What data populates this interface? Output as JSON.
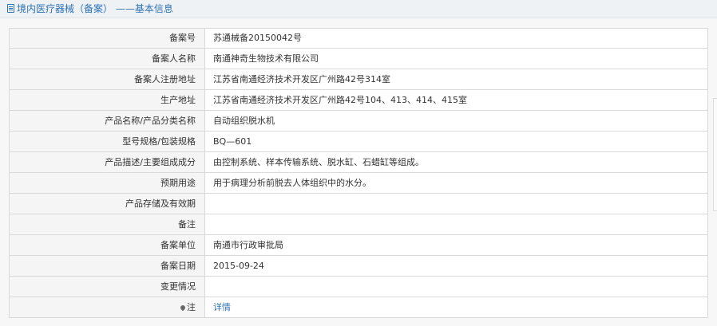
{
  "header": {
    "title": "境内医疗器械（备案） ——基本信息"
  },
  "rows": [
    {
      "label": "备案号",
      "value": "苏通械备20150042号"
    },
    {
      "label": "备案人名称",
      "value": "南通神奇生物技术有限公司"
    },
    {
      "label": "备案人注册地址",
      "value": "江苏省南通经济技术开发区广州路42号314室"
    },
    {
      "label": "生产地址",
      "value": "江苏省南通经济技术开发区广州路42号104、413、414、415室"
    },
    {
      "label": "产品名称/产品分类名称",
      "value": "自动组织脱水机"
    },
    {
      "label": "型号规格/包装规格",
      "value": "BQ—601"
    },
    {
      "label": "产品描述/主要组成成分",
      "value": "由控制系统、样本传输系统、脱水缸、石蜡缸等组成。"
    },
    {
      "label": "预期用途",
      "value": "用于病理分析前脱去人体组织中的水分。"
    },
    {
      "label": "产品存储及有效期",
      "value": ""
    },
    {
      "label": "备注",
      "value": ""
    },
    {
      "label": "备案单位",
      "value": "南通市行政审批局"
    },
    {
      "label": "备案日期",
      "value": "2015-09-24"
    },
    {
      "label": "变更情况",
      "value": ""
    }
  ],
  "note": {
    "label": "注",
    "link": "详情",
    "icon": "pin-icon"
  },
  "colors": {
    "accent": "#2f73b3",
    "label_bg": "#f5f5f5",
    "border": "#d9d9d9"
  }
}
